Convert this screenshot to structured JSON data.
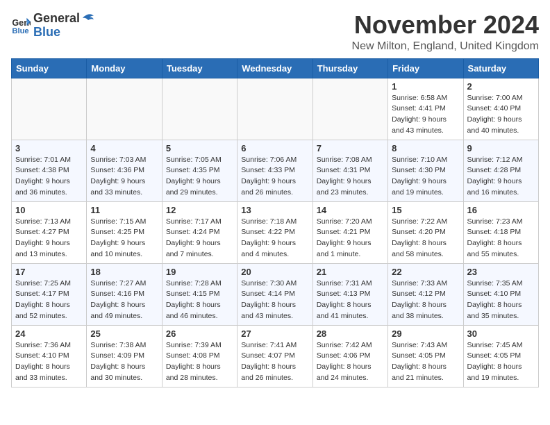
{
  "header": {
    "logo_general": "General",
    "logo_blue": "Blue",
    "month_title": "November 2024",
    "location": "New Milton, England, United Kingdom"
  },
  "days_of_week": [
    "Sunday",
    "Monday",
    "Tuesday",
    "Wednesday",
    "Thursday",
    "Friday",
    "Saturday"
  ],
  "weeks": [
    [
      {
        "day": "",
        "info": ""
      },
      {
        "day": "",
        "info": ""
      },
      {
        "day": "",
        "info": ""
      },
      {
        "day": "",
        "info": ""
      },
      {
        "day": "",
        "info": ""
      },
      {
        "day": "1",
        "info": "Sunrise: 6:58 AM\nSunset: 4:41 PM\nDaylight: 9 hours\nand 43 minutes."
      },
      {
        "day": "2",
        "info": "Sunrise: 7:00 AM\nSunset: 4:40 PM\nDaylight: 9 hours\nand 40 minutes."
      }
    ],
    [
      {
        "day": "3",
        "info": "Sunrise: 7:01 AM\nSunset: 4:38 PM\nDaylight: 9 hours\nand 36 minutes."
      },
      {
        "day": "4",
        "info": "Sunrise: 7:03 AM\nSunset: 4:36 PM\nDaylight: 9 hours\nand 33 minutes."
      },
      {
        "day": "5",
        "info": "Sunrise: 7:05 AM\nSunset: 4:35 PM\nDaylight: 9 hours\nand 29 minutes."
      },
      {
        "day": "6",
        "info": "Sunrise: 7:06 AM\nSunset: 4:33 PM\nDaylight: 9 hours\nand 26 minutes."
      },
      {
        "day": "7",
        "info": "Sunrise: 7:08 AM\nSunset: 4:31 PM\nDaylight: 9 hours\nand 23 minutes."
      },
      {
        "day": "8",
        "info": "Sunrise: 7:10 AM\nSunset: 4:30 PM\nDaylight: 9 hours\nand 19 minutes."
      },
      {
        "day": "9",
        "info": "Sunrise: 7:12 AM\nSunset: 4:28 PM\nDaylight: 9 hours\nand 16 minutes."
      }
    ],
    [
      {
        "day": "10",
        "info": "Sunrise: 7:13 AM\nSunset: 4:27 PM\nDaylight: 9 hours\nand 13 minutes."
      },
      {
        "day": "11",
        "info": "Sunrise: 7:15 AM\nSunset: 4:25 PM\nDaylight: 9 hours\nand 10 minutes."
      },
      {
        "day": "12",
        "info": "Sunrise: 7:17 AM\nSunset: 4:24 PM\nDaylight: 9 hours\nand 7 minutes."
      },
      {
        "day": "13",
        "info": "Sunrise: 7:18 AM\nSunset: 4:22 PM\nDaylight: 9 hours\nand 4 minutes."
      },
      {
        "day": "14",
        "info": "Sunrise: 7:20 AM\nSunset: 4:21 PM\nDaylight: 9 hours\nand 1 minute."
      },
      {
        "day": "15",
        "info": "Sunrise: 7:22 AM\nSunset: 4:20 PM\nDaylight: 8 hours\nand 58 minutes."
      },
      {
        "day": "16",
        "info": "Sunrise: 7:23 AM\nSunset: 4:18 PM\nDaylight: 8 hours\nand 55 minutes."
      }
    ],
    [
      {
        "day": "17",
        "info": "Sunrise: 7:25 AM\nSunset: 4:17 PM\nDaylight: 8 hours\nand 52 minutes."
      },
      {
        "day": "18",
        "info": "Sunrise: 7:27 AM\nSunset: 4:16 PM\nDaylight: 8 hours\nand 49 minutes."
      },
      {
        "day": "19",
        "info": "Sunrise: 7:28 AM\nSunset: 4:15 PM\nDaylight: 8 hours\nand 46 minutes."
      },
      {
        "day": "20",
        "info": "Sunrise: 7:30 AM\nSunset: 4:14 PM\nDaylight: 8 hours\nand 43 minutes."
      },
      {
        "day": "21",
        "info": "Sunrise: 7:31 AM\nSunset: 4:13 PM\nDaylight: 8 hours\nand 41 minutes."
      },
      {
        "day": "22",
        "info": "Sunrise: 7:33 AM\nSunset: 4:12 PM\nDaylight: 8 hours\nand 38 minutes."
      },
      {
        "day": "23",
        "info": "Sunrise: 7:35 AM\nSunset: 4:10 PM\nDaylight: 8 hours\nand 35 minutes."
      }
    ],
    [
      {
        "day": "24",
        "info": "Sunrise: 7:36 AM\nSunset: 4:10 PM\nDaylight: 8 hours\nand 33 minutes."
      },
      {
        "day": "25",
        "info": "Sunrise: 7:38 AM\nSunset: 4:09 PM\nDaylight: 8 hours\nand 30 minutes."
      },
      {
        "day": "26",
        "info": "Sunrise: 7:39 AM\nSunset: 4:08 PM\nDaylight: 8 hours\nand 28 minutes."
      },
      {
        "day": "27",
        "info": "Sunrise: 7:41 AM\nSunset: 4:07 PM\nDaylight: 8 hours\nand 26 minutes."
      },
      {
        "day": "28",
        "info": "Sunrise: 7:42 AM\nSunset: 4:06 PM\nDaylight: 8 hours\nand 24 minutes."
      },
      {
        "day": "29",
        "info": "Sunrise: 7:43 AM\nSunset: 4:05 PM\nDaylight: 8 hours\nand 21 minutes."
      },
      {
        "day": "30",
        "info": "Sunrise: 7:45 AM\nSunset: 4:05 PM\nDaylight: 8 hours\nand 19 minutes."
      }
    ]
  ]
}
